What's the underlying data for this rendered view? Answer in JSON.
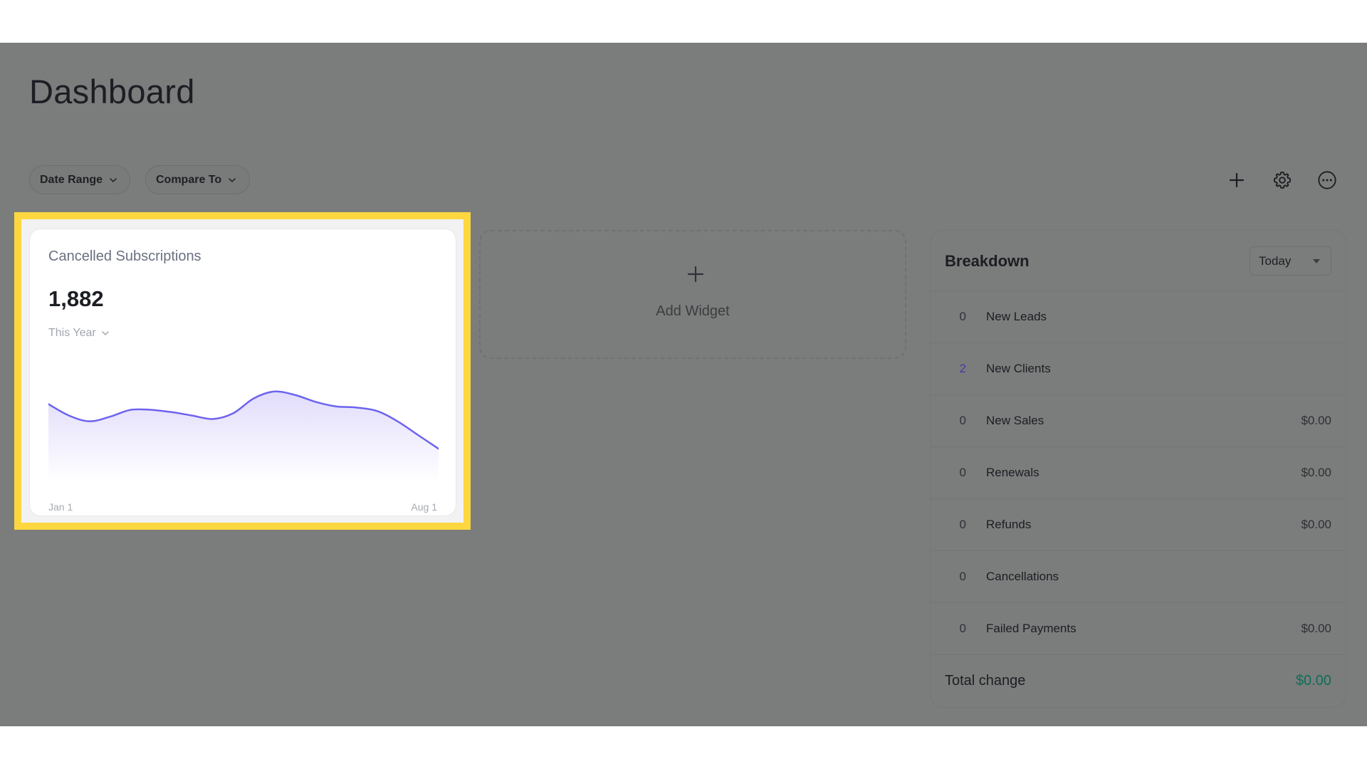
{
  "page": {
    "title": "Dashboard"
  },
  "filters": {
    "date_range_label": "Date Range",
    "compare_to_label": "Compare To"
  },
  "toolbar": {
    "add_icon": "plus-icon",
    "settings_icon": "gear-icon",
    "more_icon": "ellipsis-circle-icon"
  },
  "highlight_color": "#fdd740",
  "widget": {
    "title": "Cancelled Subscriptions",
    "value": "1,882",
    "period": "This Year",
    "x_start_label": "Jan 1",
    "x_end_label": "Aug 1"
  },
  "chart_data": {
    "type": "area",
    "x": [
      "Jan 1",
      "Aug 1"
    ],
    "values": [
      0.68,
      0.58,
      0.53,
      0.57,
      0.63,
      0.63,
      0.61,
      0.58,
      0.55,
      0.6,
      0.73,
      0.79,
      0.76,
      0.7,
      0.66,
      0.65,
      0.62,
      0.53,
      0.41,
      0.29
    ],
    "title": "",
    "xlabel": "",
    "ylabel": "",
    "line_color": "#6d63ee",
    "fill_color": "#e1dcfb",
    "grid": false
  },
  "add_widget": {
    "label": "Add Widget",
    "icon": "plus-icon"
  },
  "breakdown": {
    "title": "Breakdown",
    "period": "Today",
    "rows": [
      {
        "count": "0",
        "label": "New Leads",
        "amount": ""
      },
      {
        "count": "2",
        "label": "New Clients",
        "amount": ""
      },
      {
        "count": "0",
        "label": "New Sales",
        "amount": "$0.00"
      },
      {
        "count": "0",
        "label": "Renewals",
        "amount": "$0.00"
      },
      {
        "count": "0",
        "label": "Refunds",
        "amount": "$0.00"
      },
      {
        "count": "0",
        "label": "Cancellations",
        "amount": ""
      },
      {
        "count": "0",
        "label": "Failed Payments",
        "amount": "$0.00"
      }
    ],
    "total_label": "Total change",
    "total_value": "$0.00",
    "total_color": "#0f6d59"
  }
}
